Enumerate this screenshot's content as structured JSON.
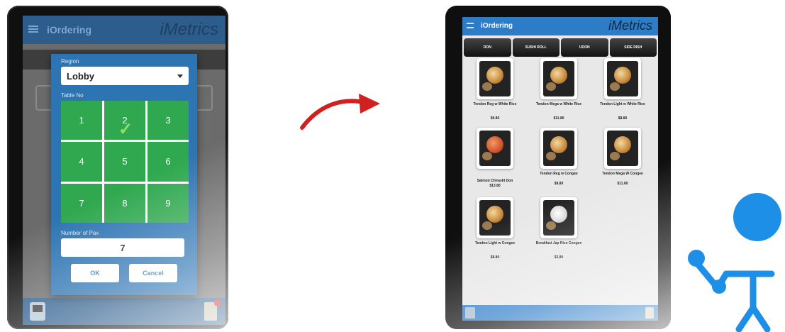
{
  "tablet1": {
    "app_title": "iOrdering",
    "brand": "iMetrics",
    "dialog": {
      "region_label": "Region",
      "region_value": "Lobby",
      "table_label": "Table No",
      "keys": [
        "1",
        "2",
        "3",
        "4",
        "5",
        "6",
        "7",
        "8",
        "9"
      ],
      "selected_key": "2",
      "pax_label": "Number of Pax",
      "pax_value": "7",
      "ok_label": "OK",
      "cancel_label": "Cancel"
    }
  },
  "tablet2": {
    "app_title": "iOrdering",
    "brand": "iMetrics",
    "tabs": [
      "DON",
      "SUSHI ROLL",
      "UDON",
      "SIDE DISH"
    ],
    "items": [
      {
        "name": "Tendon Reg w White Rice",
        "price": "$9.80"
      },
      {
        "name": "Tendon Mega w White Rice",
        "price": "$11.80"
      },
      {
        "name": "Tendon Light w White Rice",
        "price": "$8.80"
      },
      {
        "name": "Salmon Chirashi Don",
        "price": "$13.80"
      },
      {
        "name": "Tendon Reg w Congee",
        "price": "$9.80"
      },
      {
        "name": "Tendon Mega W Congee",
        "price": "$11.80"
      },
      {
        "name": "Tendon Light w Congee",
        "price": "$8.80"
      },
      {
        "name": "Breakfast Jap Rice Congee",
        "price": "$3.80"
      }
    ]
  },
  "colors": {
    "app_blue": "#2d7cc8",
    "key_green": "#2fa84f",
    "arrow_red": "#d0201f",
    "person_blue": "#1e8fe6"
  }
}
